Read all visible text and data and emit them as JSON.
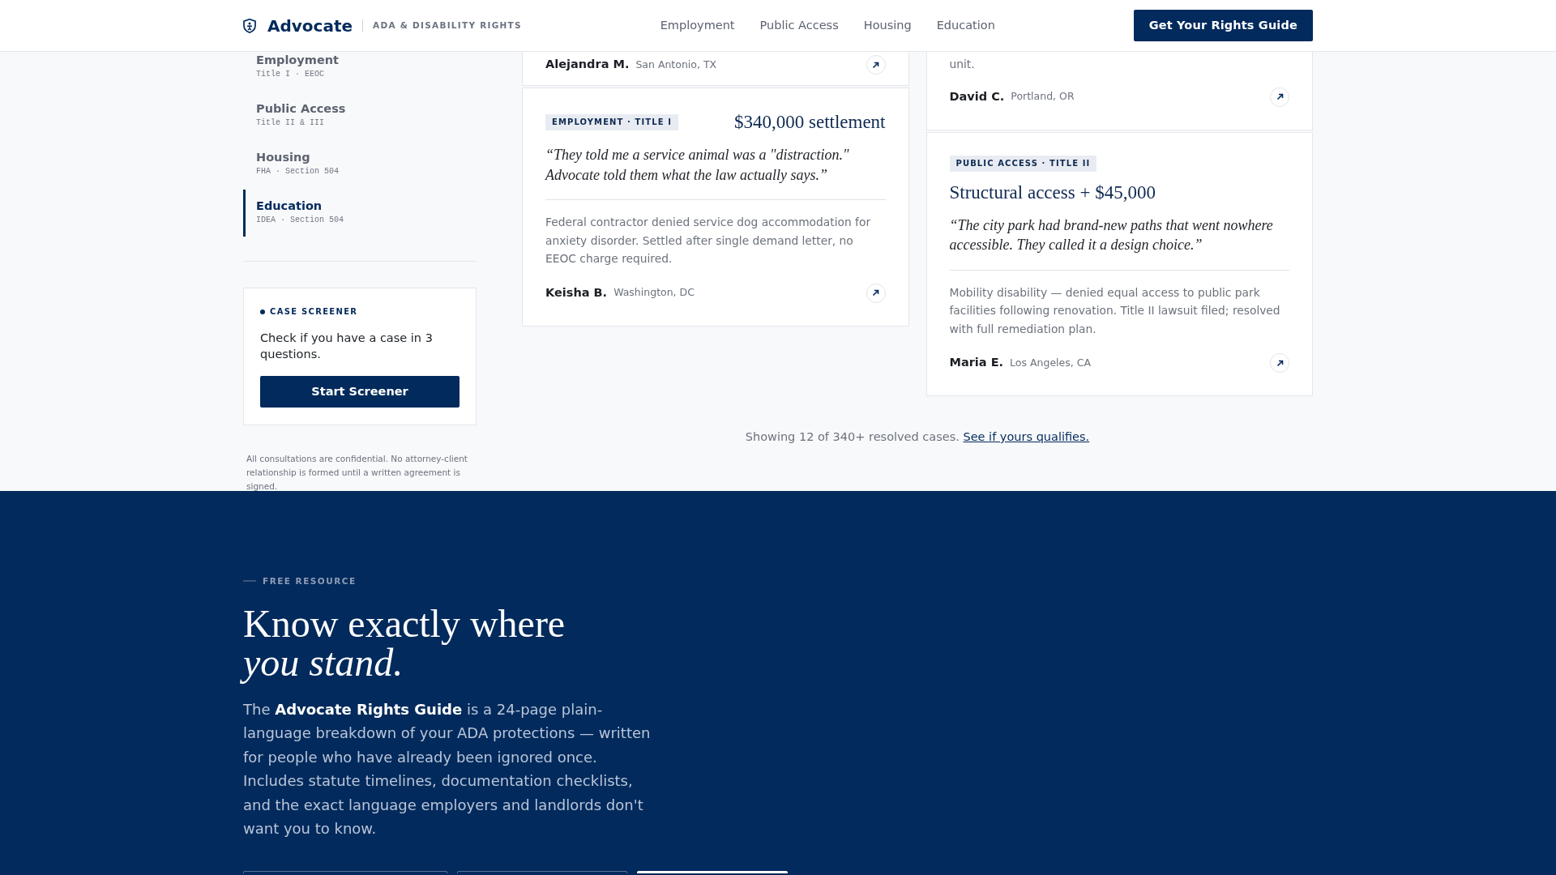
{
  "navbar": {
    "brand": "Advocate",
    "tagline": "ADA & DISABILITY RIGHTS",
    "links": [
      {
        "label": "Employment"
      },
      {
        "label": "Public Access"
      },
      {
        "label": "Housing"
      },
      {
        "label": "Education"
      }
    ],
    "cta": "Get Your Rights Guide"
  },
  "sidebar": {
    "items": [
      {
        "title": "Employment",
        "subtitle": "Title I · EEOC",
        "selected": false
      },
      {
        "title": "Public Access",
        "subtitle": "Title II & III",
        "selected": false
      },
      {
        "title": "Housing",
        "subtitle": "FHA · Section 504",
        "selected": false
      },
      {
        "title": "Education",
        "subtitle": "IDEA · Section 504",
        "selected": true
      }
    ],
    "screener": {
      "label": "CASE SCREENER",
      "text": "Check if you have a case in 3 questions.",
      "button": "Start Screener"
    },
    "footnote": "All consultations are confidential. No attorney-client relationship is formed until a written agreement is signed."
  },
  "cases": {
    "columns": [
      [
        {
          "name": "Alejandra M.",
          "location": "San Antonio, TX"
        },
        {
          "tag": "EMPLOYMENT · TITLE I",
          "headline": "$340,000 settlement",
          "quote": "“They told me a service animal was a \"distraction.\" Advocate told them what the law actually says.”",
          "description": "Federal contractor denied service dog accommodation for anxiety disorder. Settled after single demand letter, no EEOC charge required.",
          "name": "Keisha B.",
          "location": "Washington, DC"
        }
      ],
      [
        {
          "description": "unit.",
          "name": "David C.",
          "location": "Portland, OR"
        },
        {
          "tag": "PUBLIC ACCESS · TITLE II",
          "headline": "Structural access + $45,000",
          "quote": "“The city park had brand-new paths that went nowhere accessible. They called it a design choice.”",
          "description": "Mobility disability — denied equal access to public park facilities following renovation. Title II lawsuit filed; resolved with full remediation plan.",
          "name": "Maria E.",
          "location": "Los Angeles, CA"
        }
      ]
    ],
    "summary": "Showing 12 of 340+ resolved cases.",
    "summary_link": "See if yours qualifies."
  },
  "resource": {
    "eyebrow": "FREE RESOURCE",
    "heading": "Know exactly where",
    "heading_emphasis": "you stand.",
    "body": "The **Advocate Rights Guide** is a 24-page plain-language breakdown of your ADA protections — written for people who have already been ignored once. Includes statute timelines, documentation checklists, and the exact language employers and landlords don't want you to know.",
    "form": [
      {
        "kind": "input"
      },
      {
        "kind": "input"
      },
      {
        "kind": "button"
      }
    ]
  }
}
